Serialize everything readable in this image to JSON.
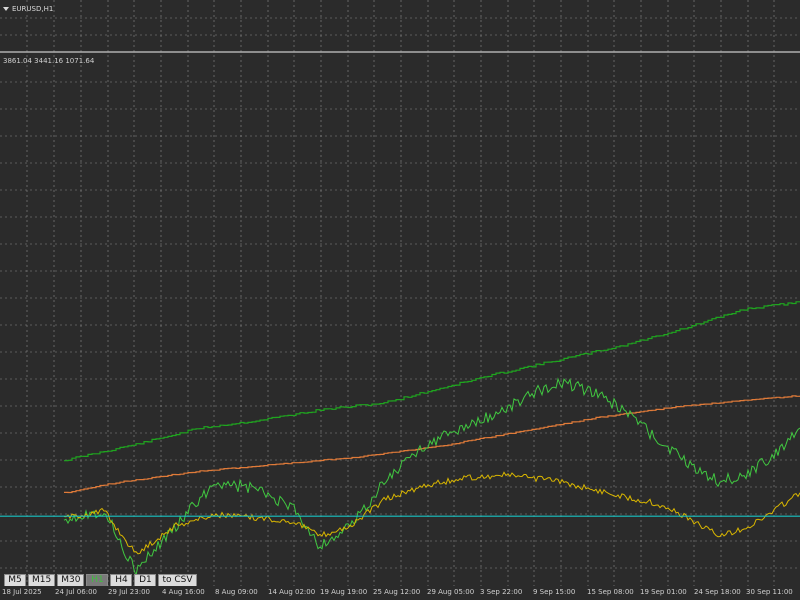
{
  "window": {
    "title": "EURUSD,H1"
  },
  "indicator": {
    "label": "3861.04 3441.16 1071.64"
  },
  "timeframes": [
    {
      "label": "M5",
      "active": false
    },
    {
      "label": "M15",
      "active": false
    },
    {
      "label": "M30",
      "active": false
    },
    {
      "label": "H1",
      "active": true
    },
    {
      "label": "H4",
      "active": false
    },
    {
      "label": "D1",
      "active": false
    },
    {
      "label": "to CSV",
      "active": false
    }
  ],
  "xaxis": {
    "labels": [
      "18 Jul 2025",
      "24 Jul 06:00",
      "29 Jul 23:00",
      "4 Aug 16:00",
      "8 Aug 09:00",
      "14 Aug 02:00",
      "19 Aug 19:00",
      "25 Aug 12:00",
      "29 Aug 05:00",
      "3 Sep 22:00",
      "9 Sep 15:00",
      "15 Sep 08:00",
      "19 Sep 01:00",
      "24 Sep 18:00",
      "30 Sep 11:00"
    ]
  },
  "colors": {
    "background": "#2b2b2b",
    "grid": "#8c8c8c",
    "green_dark": "#1fa51f",
    "green_light": "#41c841",
    "orange": "#e07b39",
    "yellow": "#d9b600",
    "cyan": "#19c3c3"
  },
  "chart_data": {
    "type": "line",
    "y_scale": "price",
    "series": [
      {
        "key": "green_dark",
        "points": [
          [
            0.08,
            0.36
          ],
          [
            0.12,
            0.38
          ],
          [
            0.18,
            0.41
          ],
          [
            0.25,
            0.45
          ],
          [
            0.32,
            0.47
          ],
          [
            0.4,
            0.5
          ],
          [
            0.48,
            0.52
          ],
          [
            0.55,
            0.56
          ],
          [
            0.62,
            0.6
          ],
          [
            0.7,
            0.64
          ],
          [
            0.78,
            0.68
          ],
          [
            0.86,
            0.73
          ],
          [
            0.93,
            0.78
          ],
          [
            1.0,
            0.8
          ]
        ]
      },
      {
        "key": "orange",
        "points": [
          [
            0.08,
            0.27
          ],
          [
            0.15,
            0.3
          ],
          [
            0.25,
            0.33
          ],
          [
            0.35,
            0.35
          ],
          [
            0.45,
            0.37
          ],
          [
            0.55,
            0.4
          ],
          [
            0.65,
            0.44
          ],
          [
            0.75,
            0.48
          ],
          [
            0.85,
            0.51
          ],
          [
            0.95,
            0.53
          ],
          [
            1.0,
            0.54
          ]
        ]
      },
      {
        "key": "green_light",
        "points": [
          [
            0.08,
            0.2
          ],
          [
            0.13,
            0.22
          ],
          [
            0.17,
            0.05
          ],
          [
            0.22,
            0.18
          ],
          [
            0.27,
            0.3
          ],
          [
            0.32,
            0.28
          ],
          [
            0.37,
            0.22
          ],
          [
            0.4,
            0.12
          ],
          [
            0.44,
            0.18
          ],
          [
            0.48,
            0.3
          ],
          [
            0.53,
            0.4
          ],
          [
            0.58,
            0.45
          ],
          [
            0.63,
            0.5
          ],
          [
            0.67,
            0.55
          ],
          [
            0.7,
            0.58
          ],
          [
            0.74,
            0.55
          ],
          [
            0.78,
            0.5
          ],
          [
            0.82,
            0.42
          ],
          [
            0.86,
            0.35
          ],
          [
            0.9,
            0.3
          ],
          [
            0.94,
            0.33
          ],
          [
            0.98,
            0.4
          ],
          [
            1.0,
            0.45
          ]
        ]
      },
      {
        "key": "yellow",
        "points": [
          [
            0.08,
            0.2
          ],
          [
            0.13,
            0.22
          ],
          [
            0.17,
            0.1
          ],
          [
            0.22,
            0.18
          ],
          [
            0.27,
            0.21
          ],
          [
            0.32,
            0.2
          ],
          [
            0.37,
            0.19
          ],
          [
            0.4,
            0.15
          ],
          [
            0.44,
            0.18
          ],
          [
            0.48,
            0.25
          ],
          [
            0.53,
            0.29
          ],
          [
            0.58,
            0.31
          ],
          [
            0.63,
            0.32
          ],
          [
            0.67,
            0.31
          ],
          [
            0.7,
            0.3
          ],
          [
            0.74,
            0.28
          ],
          [
            0.78,
            0.26
          ],
          [
            0.82,
            0.24
          ],
          [
            0.86,
            0.2
          ],
          [
            0.9,
            0.15
          ],
          [
            0.94,
            0.18
          ],
          [
            0.98,
            0.24
          ],
          [
            1.0,
            0.27
          ]
        ]
      }
    ],
    "hline": {
      "key": "cyan",
      "value": 0.205
    }
  }
}
